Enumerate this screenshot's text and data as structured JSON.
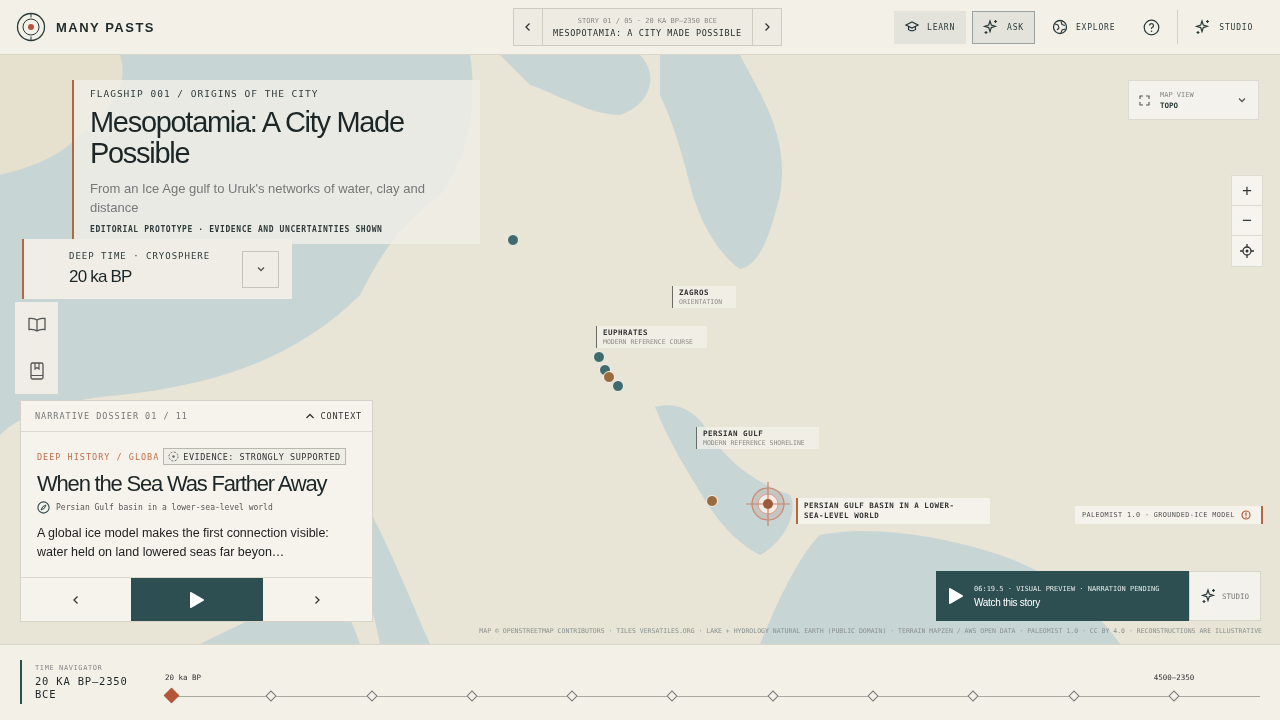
{
  "brand": {
    "name": "MANY PASTS"
  },
  "story_switcher": {
    "meta": "STORY 01 / 05 · 20 KA BP–2350 BCE",
    "title": "MESOPOTAMIA: A CITY MADE POSSIBLE"
  },
  "nav": [
    {
      "kind": "learn",
      "label": "LEARN",
      "highlighted": true,
      "selected": false
    },
    {
      "kind": "ask",
      "label": "ASK",
      "highlighted": true,
      "selected": true
    },
    {
      "kind": "explore",
      "label": "EXPLORE",
      "highlighted": false,
      "selected": false
    },
    {
      "kind": "help",
      "highlighted": false,
      "selected": false
    },
    {
      "kind": "studio",
      "label": "STUDIO",
      "highlighted": false,
      "selected": false
    }
  ],
  "hero": {
    "eyebrow": "FLAGSHIP 001 / ORIGINS OF THE CITY",
    "title": "Mesopotamia: A City Made Possible",
    "subtitle": "From an Ice Age gulf to Uruk's networks of water, clay and distance",
    "note": "EDITORIAL PROTOTYPE · EVIDENCE AND UNCERTAINTIES SHOWN"
  },
  "deep_time": {
    "label": "DEEP TIME · CRYOSPHERE",
    "value": "20 ka BP"
  },
  "side_tools": [
    {
      "kind": "book"
    },
    {
      "kind": "bookmark"
    }
  ],
  "map_view": {
    "label": "MAP VIEW",
    "value": "TOPO"
  },
  "zoom_controls": [
    {
      "kind": "text",
      "label": "+"
    },
    {
      "kind": "text",
      "label": "−"
    },
    {
      "kind": "locate"
    }
  ],
  "map_labels": [
    {
      "kind": "minor",
      "title": "ZAGROS",
      "subtitle": "ORIENTATION"
    },
    {
      "kind": "minor",
      "title": "EUPHRATES",
      "subtitle": "MODERN REFERENCE COURSE"
    },
    {
      "kind": "minor",
      "title": "PERSIAN GULF",
      "subtitle": "MODERN REFERENCE SHORELINE"
    },
    {
      "kind": "featured",
      "title": "PERSIAN GULF BASIN IN A LOWER-SEA-LEVEL WORLD"
    }
  ],
  "map_markers": [
    {
      "color": "#3f6b6f"
    },
    {
      "color": "#3f6b6f"
    },
    {
      "color": "#3f6b6f"
    },
    {
      "color": "#9b6a3c"
    },
    {
      "color": "#3f6b6f"
    },
    {
      "color": "#9b6a3c"
    }
  ],
  "model_tag": {
    "text": "PALEOMIST 1.0 · GROUNDED-ICE MODEL"
  },
  "watch": {
    "meta": "06:19.5 · VISUAL PREVIEW · NARRATION PENDING",
    "title": "Watch this story",
    "studio": "STUDIO"
  },
  "attribution": "MAP © OPENSTREETMAP CONTRIBUTORS · TILES VERSATILES.ORG · LAKE + HYDROLOGY NATURAL EARTH (PUBLIC DOMAIN) · TERRAIN MAPZEN / AWS OPEN DATA · PALEOMIST 1.0 · CC BY 4.0 · RECONSTRUCTIONS ARE ILLUSTRATIVE",
  "dossier": {
    "header": "NARRATIVE DOSSIER 01 / 11",
    "context": "CONTEXT",
    "expanded": true,
    "category": "DEEP HISTORY / GLOBA",
    "evidence": "EVIDENCE: STRONGLY SUPPORTED",
    "title": "When the Sea Was Farther Away",
    "location": "Persian Gulf basin in a lower-sea-level world",
    "body": "A global ice model makes the first connection visible: water held on land lowered seas far beyon…"
  },
  "time_navigator": {
    "label": "TIME NAVIGATOR",
    "range": "20 KA BP–2350 BCE",
    "stops": [
      {
        "label": "20 ka BP",
        "selected": true
      },
      {
        "selected": false
      },
      {
        "selected": false
      },
      {
        "selected": false
      },
      {
        "selected": false
      },
      {
        "selected": false
      },
      {
        "selected": false
      },
      {
        "selected": false
      },
      {
        "selected": false
      },
      {
        "selected": false
      },
      {
        "label": "4500–2350",
        "selected": false
      }
    ]
  }
}
